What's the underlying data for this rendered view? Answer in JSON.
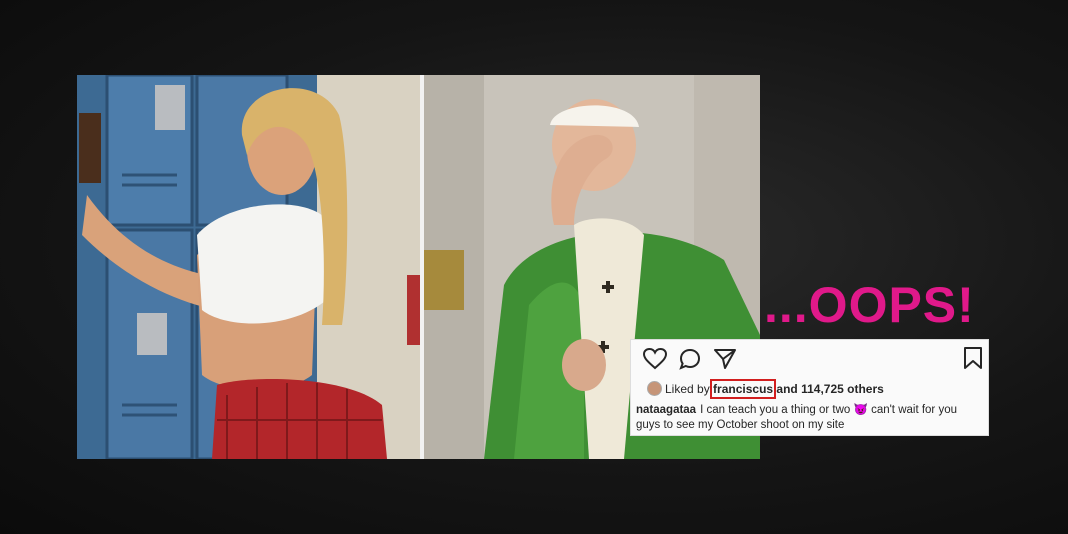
{
  "headline": "...OOPS!",
  "post": {
    "liked_prefix": "Liked by",
    "liked_user": "franciscus",
    "liked_suffix": "and 114,725 others",
    "caption_user": "nataagataa",
    "caption_before_emoji": "I can teach you a thing or two",
    "caption_emoji": "😈",
    "caption_after_emoji": "can't wait for you guys to see my October shoot on my site"
  },
  "icons": [
    "heart-icon",
    "comment-icon",
    "share-icon",
    "bookmark-icon",
    "avatar-icon",
    "devil-emoji-icon"
  ],
  "colors": {
    "headline": "#e0198a",
    "highlight_box": "#d21f1f",
    "background": "#151515"
  }
}
